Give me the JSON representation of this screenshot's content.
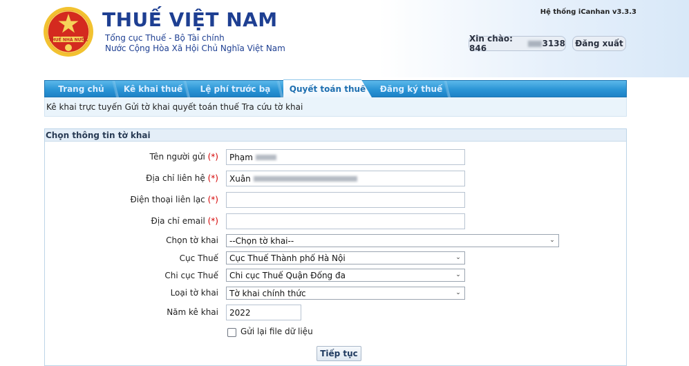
{
  "header": {
    "title": "THUẾ VIỆT NAM",
    "subtitle1": "Tổng cục Thuế - Bộ Tài chính",
    "subtitle2": "Nước Cộng Hòa Xã Hội Chủ Nghĩa Việt Nam",
    "version": "Hệ thống iCanhan v3.3.3",
    "emblem_text": "THUẾ NHÀ NƯỚC",
    "greeting_prefix": "Xin chào: 846",
    "greeting_suffix": "3138",
    "logout": "Đăng xuất"
  },
  "nav": {
    "tabs": [
      {
        "label": "Trang chủ"
      },
      {
        "label": "Kê khai thuế"
      },
      {
        "label": "Lệ phí trước bạ"
      },
      {
        "label": "Quyết toán thuế"
      },
      {
        "label": "Đăng ký thuế"
      }
    ],
    "active_index": 3,
    "subnav": [
      "Kê khai trực tuyến",
      "Gửi tờ khai quyết toán thuế",
      "Tra cứu tờ khai"
    ]
  },
  "form": {
    "panel_title": "Chọn thông tin tờ khai",
    "required_mark": "(*)",
    "sender_label": "Tên người gửi",
    "sender_value": "Phạm",
    "address_label": "Địa chỉ liên hệ",
    "address_value": "Xuân",
    "phone_label": "Điện thoại liên lạc",
    "phone_value": "",
    "email_label": "Địa chỉ email",
    "email_value": "",
    "declaration_label": "Chọn tờ khai",
    "declaration_value": "--Chọn tờ khai--",
    "tax_dept_label": "Cục Thuế",
    "tax_dept_value": "Cục Thuế Thành phố Hà Nội",
    "sub_dept_label": "Chi cục Thuế",
    "sub_dept_value": "Chi cục Thuế Quận Đống đa",
    "decl_type_label": "Loại tờ khai",
    "decl_type_value": "Tờ khai chính thức",
    "year_label": "Năm kê khai",
    "year_value": "2022",
    "resend_label": "Gửi lại file dữ liệu",
    "continue_button": "Tiếp tục"
  },
  "colors": {
    "brand_blue": "#1e3f92",
    "nav_blue": "#2b95d6",
    "required_red": "#d40000"
  }
}
